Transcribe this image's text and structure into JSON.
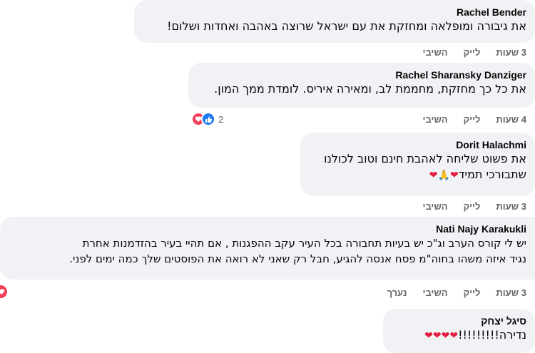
{
  "comments": [
    {
      "author": "Rachel Bender",
      "text_lines": [
        "את גיבורה ומופלאה ומחזקת את עם ישראל שרוצה באהבה ואחדות ושלום!"
      ],
      "time": "3 שעות",
      "like": "לייק",
      "reply": "השיבי"
    },
    {
      "author": "Rachel Sharansky Danziger",
      "text_lines": [
        "את כל כך מחזקת, מחממת לב, ומאירה איריס. לומדת ממך המון."
      ],
      "time": "4 שעות",
      "like": "לייק",
      "reply": "השיבי",
      "reactions": {
        "count": "2",
        "icons": [
          "like-icon",
          "heart-icon"
        ]
      }
    },
    {
      "author": "Dorit Halachmi",
      "text_lines": [
        "את פשוט שליחה לאהבת חינם וטוב לכולנו",
        "שתבורכי תמיד"
      ],
      "emoji": "❤🙏❤",
      "time": "3 שעות",
      "like": "לייק",
      "reply": "השיבי"
    },
    {
      "author": "Nati Najy Karakukli",
      "text_lines": [
        "יש לי קורס הערב וג\"כ יש בעיות תחבורה בכל העיר עקב ההפגנות , אם תהיי בעיר בהזדמנות אחרת",
        "נגיד איזה משהו בחוה\"מ פסח אנסה להגיע, חבל רק שאני לא רואה את הפוסטים שלך כמה ימים לפני."
      ],
      "time": "3 שעות",
      "like": "לייק",
      "reply": "השיבי",
      "edited": "נערך"
    },
    {
      "author": "סיגל יצחק",
      "text_lines": [
        "נדירה!!!!!!!!!"
      ],
      "emoji": "❤❤❤❤",
      "time": "",
      "like": "",
      "reply": ""
    }
  ],
  "colors": {
    "bubble": "#f0f2f5",
    "meta": "#65676b",
    "heart": "#e41e3f",
    "like_blue": "#1877f2"
  }
}
